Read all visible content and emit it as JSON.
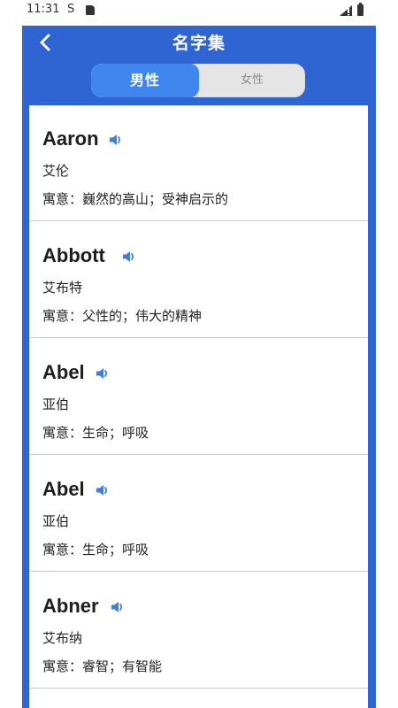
{
  "status_bar": {
    "time": "11:31",
    "sync_glyph": "S"
  },
  "header": {
    "title": "名字集"
  },
  "gender_toggle": {
    "male": "男性",
    "female": "女性",
    "selected": "male"
  },
  "meaning_prefix": "寓意：",
  "colors": {
    "header_bg": "#2f64d3",
    "toggle_active": "#3f87ef",
    "speaker": "#3f7fdc"
  },
  "names": [
    {
      "en": "Aaron",
      "zh": "艾伦",
      "meaning": "巍然的高山；受神启示的"
    },
    {
      "en": "Abbott",
      "zh": "艾布特",
      "meaning": "父性的；伟大的精神"
    },
    {
      "en": "Abel",
      "zh": "亚伯",
      "meaning": "生命；呼吸"
    },
    {
      "en": "Abel",
      "zh": "亚伯",
      "meaning": "生命；呼吸"
    },
    {
      "en": "Abner",
      "zh": "艾布纳",
      "meaning": "睿智；有智能"
    }
  ]
}
